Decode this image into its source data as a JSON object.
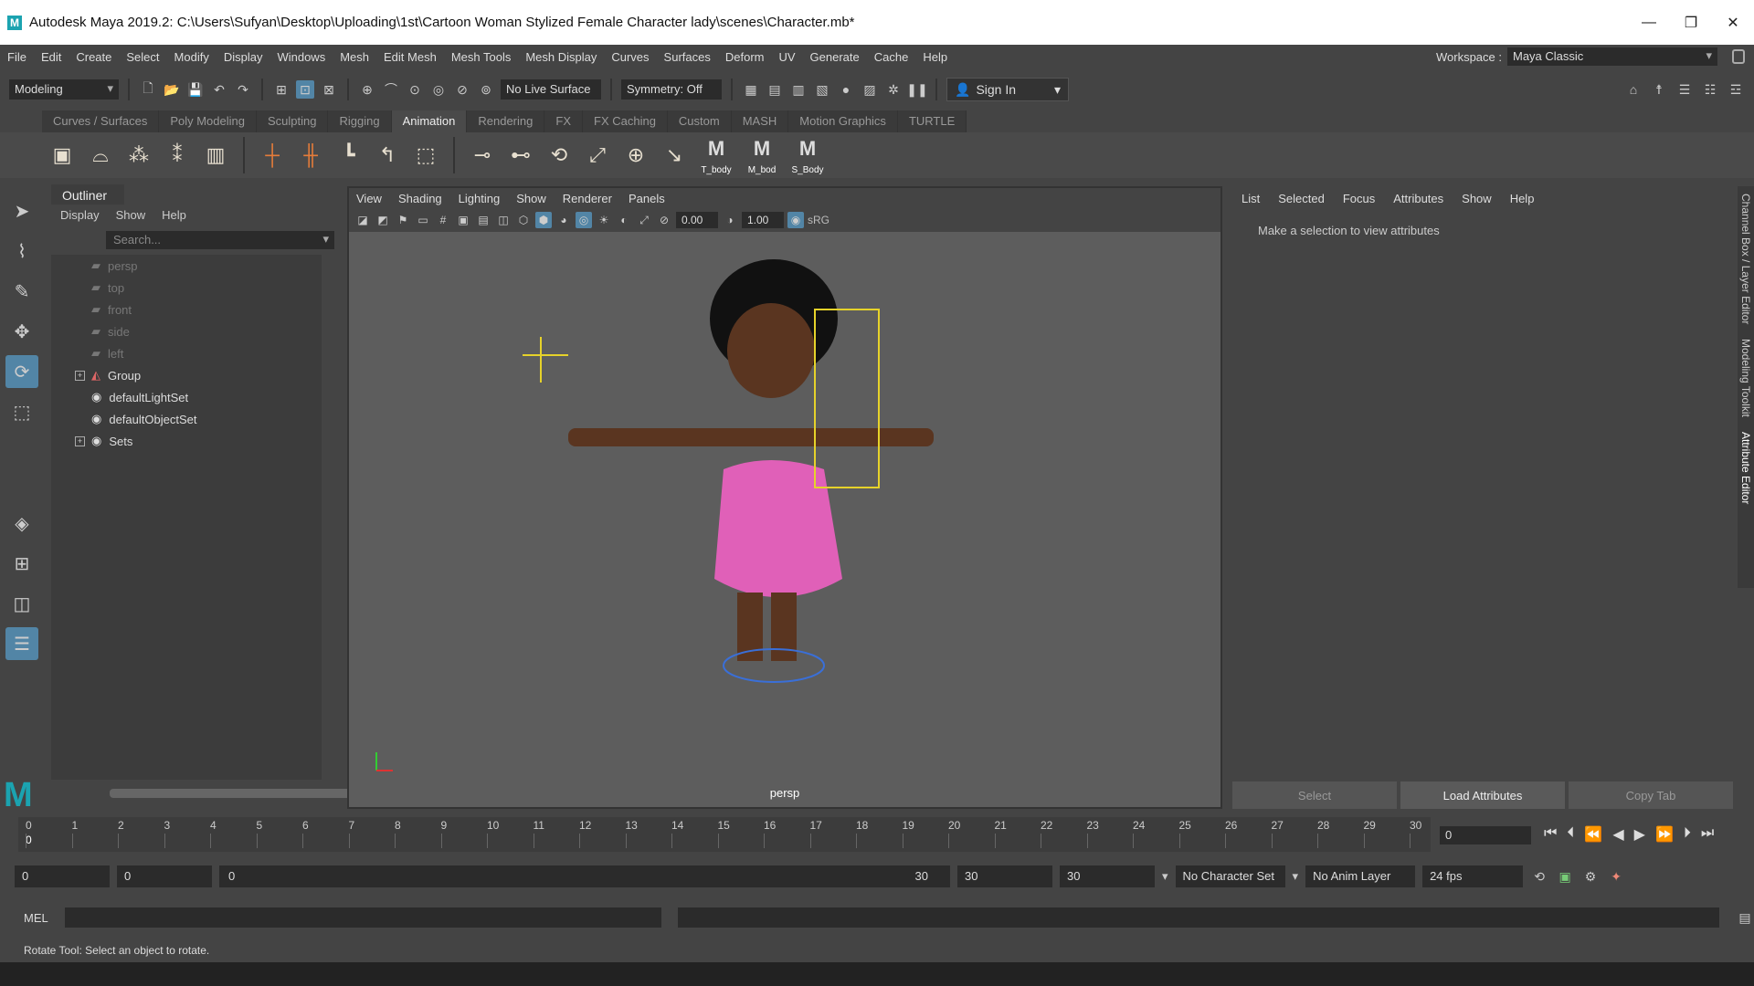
{
  "window": {
    "title": "Autodesk Maya 2019.2: C:\\Users\\Sufyan\\Desktop\\Uploading\\1st\\Cartoon Woman Stylized Female Character lady\\scenes\\Character.mb*",
    "app_icon": "M"
  },
  "menu": [
    "File",
    "Edit",
    "Create",
    "Select",
    "Modify",
    "Display",
    "Windows",
    "Mesh",
    "Edit Mesh",
    "Mesh Tools",
    "Mesh Display",
    "Curves",
    "Surfaces",
    "Deform",
    "UV",
    "Generate",
    "Cache",
    "Help"
  ],
  "workspace": {
    "label": "Workspace :",
    "value": "Maya Classic"
  },
  "status": {
    "mode": "Modeling",
    "live_surface": "No Live Surface",
    "symmetry": "Symmetry: Off",
    "sign_in": "Sign In"
  },
  "shelf": {
    "tabs": [
      "Curves / Surfaces",
      "Poly Modeling",
      "Sculpting",
      "Rigging",
      "Animation",
      "Rendering",
      "FX",
      "FX Caching",
      "Custom",
      "MASH",
      "Motion Graphics",
      "TURTLE"
    ],
    "active": "Animation",
    "custom_buttons": [
      "T_body",
      "M_bod",
      "S_Body"
    ]
  },
  "outliner": {
    "title": "Outliner",
    "menu": [
      "Display",
      "Show",
      "Help"
    ],
    "search_placeholder": "Search...",
    "items": [
      {
        "label": "persp",
        "dim": true,
        "expandable": false
      },
      {
        "label": "top",
        "dim": true,
        "expandable": false
      },
      {
        "label": "front",
        "dim": true,
        "expandable": false
      },
      {
        "label": "side",
        "dim": true,
        "expandable": false
      },
      {
        "label": "left",
        "dim": true,
        "expandable": false
      },
      {
        "label": "Group",
        "dim": false,
        "expandable": true
      },
      {
        "label": "defaultLightSet",
        "dim": false,
        "expandable": false
      },
      {
        "label": "defaultObjectSet",
        "dim": false,
        "expandable": false
      },
      {
        "label": "Sets",
        "dim": false,
        "expandable": true
      }
    ]
  },
  "viewport": {
    "menu": [
      "View",
      "Shading",
      "Lighting",
      "Show",
      "Renderer",
      "Panels"
    ],
    "near": "0.00",
    "far": "1.00",
    "color_space": "sRG",
    "camera_label": "persp"
  },
  "attribute_editor": {
    "menu": [
      "List",
      "Selected",
      "Focus",
      "Attributes",
      "Show",
      "Help"
    ],
    "message": "Make a selection to view attributes",
    "buttons": [
      "Select",
      "Load Attributes",
      "Copy Tab"
    ],
    "side_tabs": [
      "Channel Box / Layer Editor",
      "Modeling Toolkit",
      "Attribute Editor"
    ]
  },
  "timeline": {
    "ticks": [
      "0",
      "1",
      "2",
      "3",
      "4",
      "5",
      "6",
      "7",
      "8",
      "9",
      "10",
      "11",
      "12",
      "13",
      "14",
      "15",
      "16",
      "17",
      "18",
      "19",
      "20",
      "21",
      "22",
      "23",
      "24",
      "25",
      "26",
      "27",
      "28",
      "29",
      "30"
    ],
    "current_marker": "0",
    "current_frame": "0"
  },
  "range": {
    "start": "0",
    "anim_start": "0",
    "slider_start": "0",
    "slider_end": "30",
    "anim_end": "30",
    "end": "30",
    "character_set": "No Character Set",
    "anim_layer": "No Anim Layer",
    "fps": "24 fps"
  },
  "command": {
    "label": "MEL"
  },
  "help_line": "Rotate Tool: Select an object to rotate."
}
